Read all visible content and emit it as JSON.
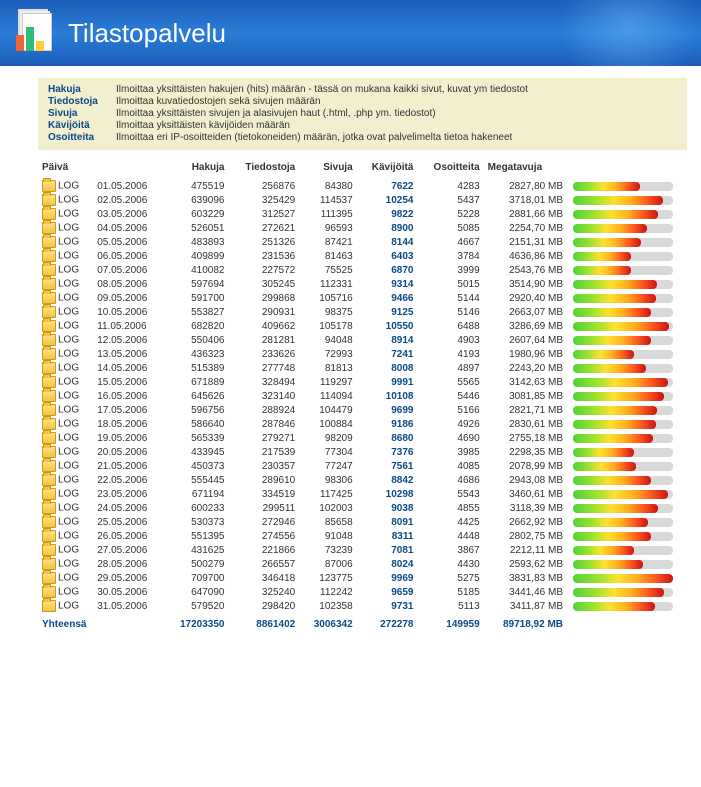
{
  "header": {
    "title": "Tilastopalvelu"
  },
  "legend": [
    {
      "label": "Hakuja",
      "text": "Ilmoittaa yksittäisten hakujen (hits) määrän - tässä on mukana kaikki sivut, kuvat ym tiedostot"
    },
    {
      "label": "Tiedostoja",
      "text": "Ilmoittaa kuvatiedostojen sekä sivujen määrän"
    },
    {
      "label": "Sivuja",
      "text": "Ilmoittaa yksittäisten sivujen ja alasivujen haut (.html, .php ym. tiedostot)"
    },
    {
      "label": "Kävijöitä",
      "text": "Ilmoittaa yksittäisten kävijöiden määrän"
    },
    {
      "label": "Osoitteita",
      "text": "Ilmoittaa eri IP-osoitteiden (tietokoneiden) määrän, jotka ovat palvelimelta tietoa hakeneet"
    }
  ],
  "columns": {
    "paiva": "Päivä",
    "hakuja": "Hakuja",
    "tiedostoja": "Tiedostoja",
    "sivuja": "Sivuja",
    "kavijoita": "Kävijöitä",
    "osoitteita": "Osoitteita",
    "megatavuja": "Megatavuja"
  },
  "log_label": "LOG",
  "rows": [
    {
      "date": "01.05.2006",
      "hits": 475519,
      "files": 256876,
      "pages": 84380,
      "visits": 7622,
      "addr": 4283,
      "mb": "2827,80 MB"
    },
    {
      "date": "02.05.2006",
      "hits": 639096,
      "files": 325429,
      "pages": 114537,
      "visits": 10254,
      "addr": 5437,
      "mb": "3718,01 MB"
    },
    {
      "date": "03.05.2006",
      "hits": 603229,
      "files": 312527,
      "pages": 111395,
      "visits": 9822,
      "addr": 5228,
      "mb": "2881,66 MB"
    },
    {
      "date": "04.05.2006",
      "hits": 526051,
      "files": 272621,
      "pages": 96593,
      "visits": 8900,
      "addr": 5085,
      "mb": "2254,70 MB"
    },
    {
      "date": "05.05.2006",
      "hits": 483893,
      "files": 251326,
      "pages": 87421,
      "visits": 8144,
      "addr": 4667,
      "mb": "2151,31 MB"
    },
    {
      "date": "06.05.2006",
      "hits": 409899,
      "files": 231536,
      "pages": 81463,
      "visits": 6403,
      "addr": 3784,
      "mb": "4636,86 MB"
    },
    {
      "date": "07.05.2006",
      "hits": 410082,
      "files": 227572,
      "pages": 75525,
      "visits": 6870,
      "addr": 3999,
      "mb": "2543,76 MB"
    },
    {
      "date": "08.05.2006",
      "hits": 597694,
      "files": 305245,
      "pages": 112331,
      "visits": 9314,
      "addr": 5015,
      "mb": "3514,90 MB"
    },
    {
      "date": "09.05.2006",
      "hits": 591700,
      "files": 299868,
      "pages": 105716,
      "visits": 9466,
      "addr": 5144,
      "mb": "2920,40 MB"
    },
    {
      "date": "10.05.2006",
      "hits": 553827,
      "files": 290931,
      "pages": 98375,
      "visits": 9125,
      "addr": 5146,
      "mb": "2663,07 MB"
    },
    {
      "date": "11.05.2006",
      "hits": 682820,
      "files": 409662,
      "pages": 105178,
      "visits": 10550,
      "addr": 6488,
      "mb": "3286,69 MB"
    },
    {
      "date": "12.05.2006",
      "hits": 550406,
      "files": 281281,
      "pages": 94048,
      "visits": 8914,
      "addr": 4903,
      "mb": "2607,64 MB"
    },
    {
      "date": "13.05.2006",
      "hits": 436323,
      "files": 233626,
      "pages": 72993,
      "visits": 7241,
      "addr": 4193,
      "mb": "1980,96 MB"
    },
    {
      "date": "14.05.2006",
      "hits": 515389,
      "files": 277748,
      "pages": 81813,
      "visits": 8008,
      "addr": 4897,
      "mb": "2243,20 MB"
    },
    {
      "date": "15.05.2006",
      "hits": 671889,
      "files": 328494,
      "pages": 119297,
      "visits": 9991,
      "addr": 5565,
      "mb": "3142,63 MB"
    },
    {
      "date": "16.05.2006",
      "hits": 645626,
      "files": 323140,
      "pages": 114094,
      "visits": 10108,
      "addr": 5446,
      "mb": "3081,85 MB"
    },
    {
      "date": "17.05.2006",
      "hits": 596756,
      "files": 288924,
      "pages": 104479,
      "visits": 9699,
      "addr": 5166,
      "mb": "2821,71 MB"
    },
    {
      "date": "18.05.2006",
      "hits": 586640,
      "files": 287846,
      "pages": 100884,
      "visits": 9186,
      "addr": 4926,
      "mb": "2830,61 MB"
    },
    {
      "date": "19.05.2006",
      "hits": 565339,
      "files": 279271,
      "pages": 98209,
      "visits": 8680,
      "addr": 4690,
      "mb": "2755,18 MB"
    },
    {
      "date": "20.05.2006",
      "hits": 433945,
      "files": 217539,
      "pages": 77304,
      "visits": 7376,
      "addr": 3985,
      "mb": "2298,35 MB"
    },
    {
      "date": "21.05.2006",
      "hits": 450373,
      "files": 230357,
      "pages": 77247,
      "visits": 7561,
      "addr": 4085,
      "mb": "2078,99 MB"
    },
    {
      "date": "22.05.2006",
      "hits": 555445,
      "files": 289610,
      "pages": 98306,
      "visits": 8842,
      "addr": 4686,
      "mb": "2943,08 MB"
    },
    {
      "date": "23.05.2006",
      "hits": 671194,
      "files": 334519,
      "pages": 117425,
      "visits": 10298,
      "addr": 5543,
      "mb": "3460,61 MB"
    },
    {
      "date": "24.05.2006",
      "hits": 600233,
      "files": 299511,
      "pages": 102003,
      "visits": 9038,
      "addr": 4855,
      "mb": "3118,39 MB"
    },
    {
      "date": "25.05.2006",
      "hits": 530373,
      "files": 272946,
      "pages": 85658,
      "visits": 8091,
      "addr": 4425,
      "mb": "2662,92 MB"
    },
    {
      "date": "26.05.2006",
      "hits": 551395,
      "files": 274556,
      "pages": 91048,
      "visits": 8311,
      "addr": 4448,
      "mb": "2802,75 MB"
    },
    {
      "date": "27.05.2006",
      "hits": 431625,
      "files": 221866,
      "pages": 73239,
      "visits": 7081,
      "addr": 3867,
      "mb": "2212,11 MB"
    },
    {
      "date": "28.05.2006",
      "hits": 500279,
      "files": 266557,
      "pages": 87006,
      "visits": 8024,
      "addr": 4430,
      "mb": "2593,62 MB"
    },
    {
      "date": "29.05.2006",
      "hits": 709700,
      "files": 346418,
      "pages": 123775,
      "visits": 9969,
      "addr": 5275,
      "mb": "3831,83 MB"
    },
    {
      "date": "30.05.2006",
      "hits": 647090,
      "files": 325240,
      "pages": 112242,
      "visits": 9659,
      "addr": 5185,
      "mb": "3441,46 MB"
    },
    {
      "date": "31.05.2006",
      "hits": 579520,
      "files": 298420,
      "pages": 102358,
      "visits": 9731,
      "addr": 5113,
      "mb": "3411,87 MB"
    }
  ],
  "totals": {
    "label": "Yhteensä",
    "hits": "17203350",
    "files": "8861402",
    "pages": "3006342",
    "visits": "272278",
    "addr": "149959",
    "mb": "89718,92 MB"
  }
}
